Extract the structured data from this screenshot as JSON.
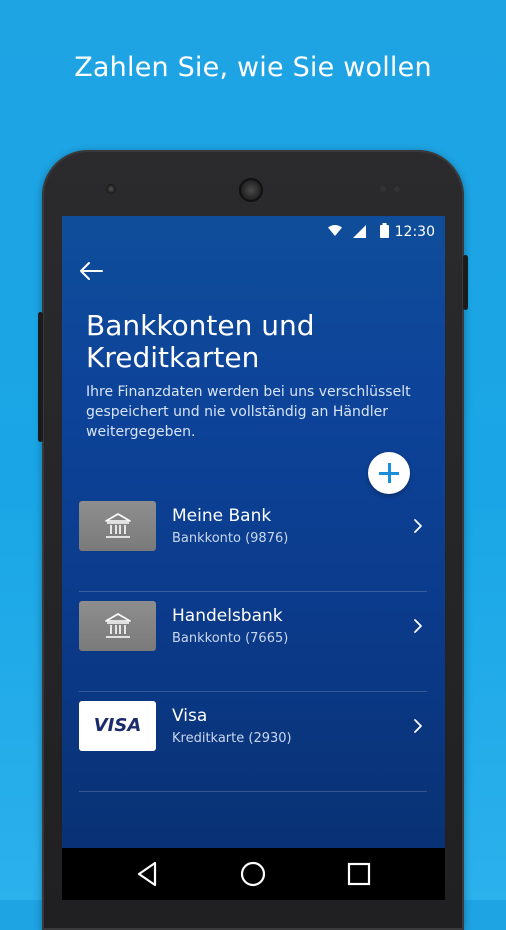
{
  "headline": "Zahlen Sie, wie Sie wollen",
  "status": {
    "time": "12:30"
  },
  "page": {
    "title_line1": "Bankkonten und",
    "title_line2": "Kreditkarten",
    "desc_line1": "Ihre Finanzdaten werden bei uns verschlüsselt",
    "desc_line2": "gespeichert und nie vollständig an Händler",
    "desc_line3": "weitergegeben."
  },
  "accounts": [
    {
      "name": "Meine Bank",
      "detail": "Bankkonto (9876)",
      "type": "bank-icon"
    },
    {
      "name": "Handelsbank",
      "detail": "Bankkonto (7665)",
      "type": "bank-icon"
    },
    {
      "name": "Visa",
      "detail": "Kreditkarte (2930)",
      "type": "visa-logo",
      "logo_text": "VISA"
    }
  ],
  "icons": {
    "back": "arrow-left-icon",
    "add": "plus-icon",
    "chevron": "chevron-right-icon",
    "nav": [
      "back-triangle-icon",
      "home-circle-icon",
      "recents-square-icon"
    ]
  },
  "colors": {
    "screen_bg": "#0d449a",
    "accent": "#1a8ed8",
    "page_bg": "#1ea3e3"
  }
}
